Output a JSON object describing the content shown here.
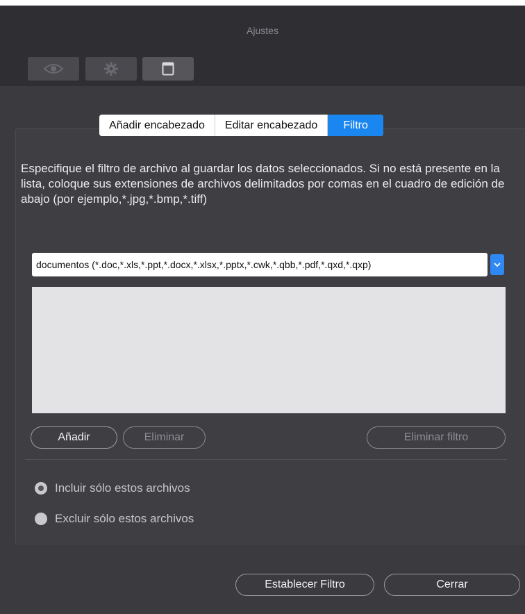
{
  "window": {
    "title": "Ajustes"
  },
  "toolbar": {
    "items": [
      {
        "icon": "eye-icon"
      },
      {
        "icon": "gear-icon"
      },
      {
        "icon": "window-icon"
      }
    ]
  },
  "tabs": [
    {
      "label": "Añadir encabezado",
      "active": false
    },
    {
      "label": "Editar encabezado",
      "active": false
    },
    {
      "label": "Filtro",
      "active": true
    }
  ],
  "description": "Especifique el filtro de archivo al guardar los datos seleccionados. Si no está presente en la lista, coloque sus extensiones de archivos delimitados por comas en el cuadro de edición de abajo (por ejemplo,*.jpg,*.bmp,*.tiff)",
  "filter_select": {
    "value": "documentos (*.doc,*.xls,*.ppt,*.docx,*.xlsx,*.pptx,*.cwk,*.qbb,*.pdf,*.qxd,*.qxp)"
  },
  "filter_list": {
    "items": []
  },
  "list_buttons": {
    "add": "Añadir",
    "remove": "Eliminar",
    "remove_filter": "Eliminar filtro"
  },
  "radio_options": {
    "include": {
      "label": "Incluir sólo estos archivos",
      "selected": true
    },
    "exclude": {
      "label": "Excluir sólo estos archivos",
      "selected": false
    }
  },
  "footer": {
    "set_filter": "Establecer Filtro",
    "close": "Cerrar"
  },
  "colors": {
    "accent": "#1a86f0",
    "window_bg": "#3b3a3f",
    "titlebar_bg": "#2f2e33"
  }
}
